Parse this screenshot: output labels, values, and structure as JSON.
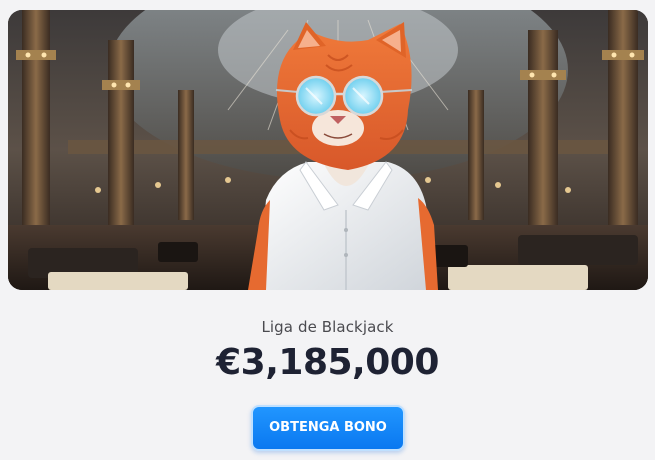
{
  "promo": {
    "title": "Liga de Blackjack",
    "amount": "€3,185,000",
    "cta_label": "OBTENGA BONO"
  },
  "hero_image": {
    "subject": "orange-cat-with-sunglasses-in-casino"
  },
  "colors": {
    "background": "#f3f3f5",
    "title_text": "#4a4a4f",
    "amount_text": "#1e2233",
    "cta_background": "#1088f8",
    "cta_text": "#ffffff"
  }
}
